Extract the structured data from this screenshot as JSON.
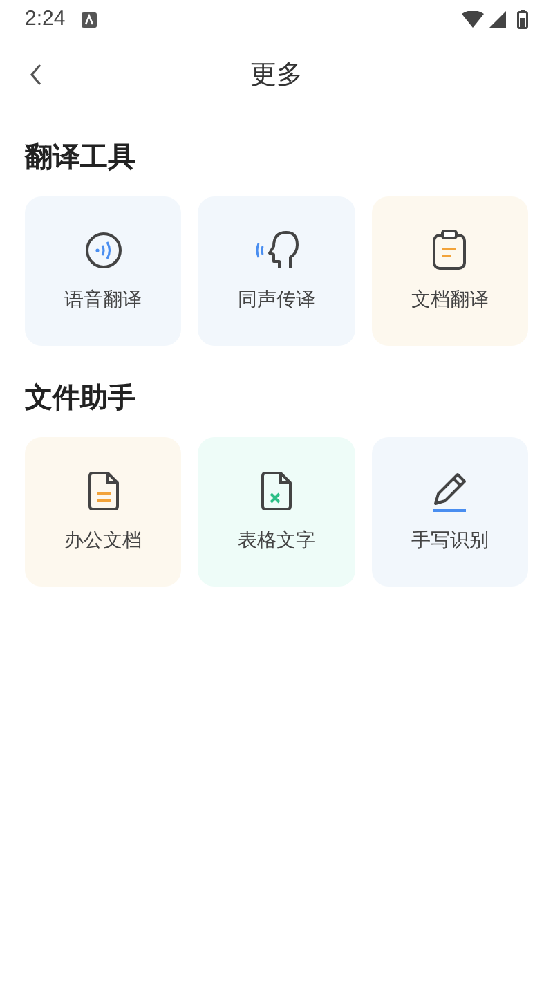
{
  "status_bar": {
    "time": "2:24"
  },
  "header": {
    "title": "更多"
  },
  "sections": [
    {
      "title": "翻译工具",
      "items": [
        {
          "label": "语音翻译",
          "kind": "voice",
          "color": "#f2f7fc"
        },
        {
          "label": "同声传译",
          "kind": "speaker",
          "color": "#f2f7fc"
        },
        {
          "label": "文档翻译",
          "kind": "clipboard",
          "color": "#fdf8ee"
        }
      ]
    },
    {
      "title": "文件助手",
      "items": [
        {
          "label": "办公文档",
          "kind": "document",
          "color": "#fdf8ee"
        },
        {
          "label": "表格文字",
          "kind": "sheet",
          "color": "#eefcf8"
        },
        {
          "label": "手写识别",
          "kind": "pen",
          "color": "#f2f7fc"
        }
      ]
    }
  ]
}
